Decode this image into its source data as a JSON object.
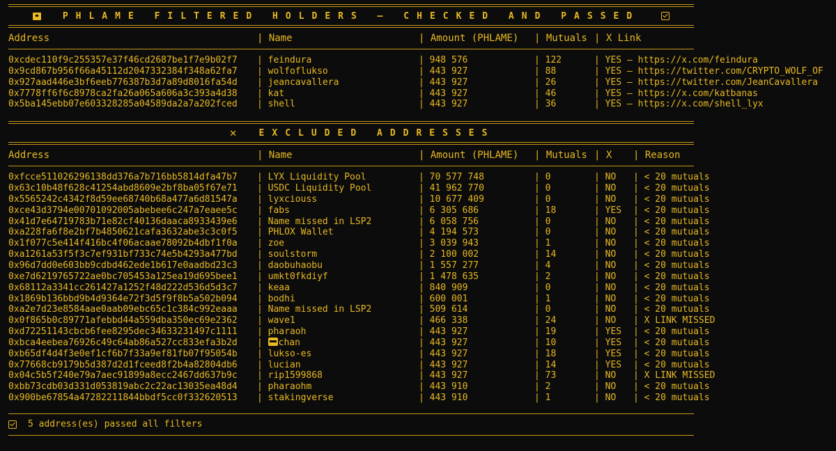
{
  "theme": {
    "fg": "#e8b923",
    "bg": "#0c0c0c"
  },
  "passed": {
    "title": "PHLAME FILTERED HOLDERS — CHECKED AND PASSED",
    "title_icon_left": "package-icon",
    "title_icon_right": "checkbox-checked-icon",
    "headers": {
      "address": "Address",
      "name": "Name",
      "amount": "Amount (PHLAME)",
      "mutuals": "Mutuals",
      "xlink": "X Link"
    },
    "rows": [
      {
        "address": "0xcdec110f9c255357e37f46cd2687be1f7e9b02f7",
        "name": "feindura",
        "amount": "948 576",
        "mutuals": "122",
        "xlink": "YES — https://x.com/feindura"
      },
      {
        "address": "0x9cd867b956f66a45112d2047332384f348a62fa7",
        "name": "wolfoflukso",
        "amount": "443 927",
        "mutuals": "88",
        "xlink": "YES — https://twitter.com/CRYPTO_WOLF_OF"
      },
      {
        "address": "0x927aad446e3bf6eeb776387b3d7a89d8016fa54d",
        "name": "jeancavallera",
        "amount": "443 927",
        "mutuals": "26",
        "xlink": "YES — https://twitter.com/JeanCavallera"
      },
      {
        "address": "0x7778ff6f6c8978ca2fa26a065a606a3c393a4d38",
        "name": "kat",
        "amount": "443 927",
        "mutuals": "46",
        "xlink": "YES — https://x.com/katbanas"
      },
      {
        "address": "0x5ba145ebb07e603328285a04589da2a7a202fced",
        "name": "shell",
        "amount": "443 927",
        "mutuals": "36",
        "xlink": "YES — https://x.com/shell_lyx"
      }
    ]
  },
  "excluded": {
    "title": "EXCLUDED ADDRESSES",
    "title_icon": "cross-icon",
    "headers": {
      "address": "Address",
      "name": "Name",
      "amount": "Amount (PHLAME)",
      "mutuals": "Mutuals",
      "x": "X",
      "reason": "Reason"
    },
    "rows": [
      {
        "address": "0xfcce511026296138dd376a7b716bb5814dfa47b7",
        "name": "LYX Liquidity Pool",
        "amount": "70 577 748",
        "mutuals": "0",
        "x": "NO",
        "reason": "< 20 mutuals"
      },
      {
        "address": "0x63c10b48f628c41254abd8609e2bf8ba05f67e71",
        "name": "USDC Liquidity Pool",
        "amount": "41 962 770",
        "mutuals": "0",
        "x": "NO",
        "reason": "< 20 mutuals"
      },
      {
        "address": "0x5565242c4342f8d59ee68740b68a477a6d81547a",
        "name": "lyxciouss",
        "amount": "10 677 409",
        "mutuals": "0",
        "x": "NO",
        "reason": "< 20 mutuals"
      },
      {
        "address": "0xce43d3794e00701092005abebee6c247a7eaee5c",
        "name": "fabs",
        "amount": "6 305 686",
        "mutuals": "18",
        "x": "YES",
        "reason": "< 20 mutuals"
      },
      {
        "address": "0x41d7e64719783b71e82cf40136daaca8933439e6",
        "name": "Name missed in LSP2",
        "amount": "6 058 756",
        "mutuals": "0",
        "x": "NO",
        "reason": "< 20 mutuals"
      },
      {
        "address": "0xa228fa6f8e2bf7b4850621cafa3632abe3c3c0f5",
        "name": "PHLOX Wallet",
        "amount": "4 194 573",
        "mutuals": "0",
        "x": "NO",
        "reason": "< 20 mutuals"
      },
      {
        "address": "0x1f077c5e414f416bc4f06acaae78092b4dbf1f0a",
        "name": "zoe",
        "amount": "3 039 943",
        "mutuals": "1",
        "x": "NO",
        "reason": "< 20 mutuals"
      },
      {
        "address": "0xa1261a53f5f3c7ef931bf733c74e5b4293a477bd",
        "name": "soulstorm",
        "amount": "2 100 002",
        "mutuals": "14",
        "x": "NO",
        "reason": "< 20 mutuals"
      },
      {
        "address": "0x96d7dd0e603bb9cdbd462ede1b617e0aadbd23c3",
        "name": "daobuhaobu",
        "amount": "1 557 277",
        "mutuals": "4",
        "x": "NO",
        "reason": "< 20 mutuals"
      },
      {
        "address": "0xe7d6219765722ae0bc705453a125ea19d695bee1",
        "name": "umkt0fkdiyf",
        "amount": "1 478 635",
        "mutuals": "2",
        "x": "NO",
        "reason": "< 20 mutuals"
      },
      {
        "address": "0x68112a3341cc261427a1252f48d222d536d5d3c7",
        "name": "keaa",
        "amount": "840 909",
        "mutuals": "0",
        "x": "NO",
        "reason": "< 20 mutuals"
      },
      {
        "address": "0x1869b136bbd9b4d9364e72f3d5f9f8b5a502b094",
        "name": "bodhi",
        "amount": "600 001",
        "mutuals": "1",
        "x": "NO",
        "reason": "< 20 mutuals"
      },
      {
        "address": "0xa2e7d23e8584aae0aab09ebc65c1c384c992eaaa",
        "name": "Name missed in LSP2",
        "amount": "509 614",
        "mutuals": "0",
        "x": "NO",
        "reason": "< 20 mutuals"
      },
      {
        "address": "0x0f865b0c89771afebbd44a559dba350ec69e2362",
        "name": "wave1",
        "amount": "466 338",
        "mutuals": "24",
        "x": "NO",
        "reason": "X LINK MISSED"
      },
      {
        "address": "0xd72251143cbcb6fee8295dec34633231497c1111",
        "name": "pharaoh",
        "amount": "443 927",
        "mutuals": "19",
        "x": "YES",
        "reason": "< 20 mutuals"
      },
      {
        "address": "0xbca4eebea76926c49c64ab86a527cc833efa3b2d",
        "name": "chan",
        "name_icon": "emoji-icon",
        "amount": "443 927",
        "mutuals": "10",
        "x": "YES",
        "reason": "< 20 mutuals"
      },
      {
        "address": "0xb65df4d4f3e0ef1cf6b7f33a9ef81fb07f95054b",
        "name": "lukso-es",
        "amount": "443 927",
        "mutuals": "18",
        "x": "YES",
        "reason": "< 20 mutuals"
      },
      {
        "address": "0x77668cb9179b5d387d2d1fceed8f2b4a82804db6",
        "name": "lucian",
        "amount": "443 927",
        "mutuals": "14",
        "x": "YES",
        "reason": "< 20 mutuals"
      },
      {
        "address": "0x04c5b5f240e79a7aec91899a8ecc2467dd637b9c",
        "name": "rip1599868",
        "amount": "443 927",
        "mutuals": "73",
        "x": "NO",
        "reason": "X LINK MISSED"
      },
      {
        "address": "0xbb73cdb03d331d053819abc2c22ac13035ea48d4",
        "name": "pharaohm",
        "amount": "443 910",
        "mutuals": "2",
        "x": "NO",
        "reason": "< 20 mutuals"
      },
      {
        "address": "0x900be67854a47282211844bbdf5cc0f332620513",
        "name": "stakingverse",
        "amount": "443 910",
        "mutuals": "1",
        "x": "NO",
        "reason": "< 20 mutuals"
      }
    ]
  },
  "footer": {
    "icon": "checkbox-checked-icon",
    "summary": "5 address(es) passed all filters"
  }
}
